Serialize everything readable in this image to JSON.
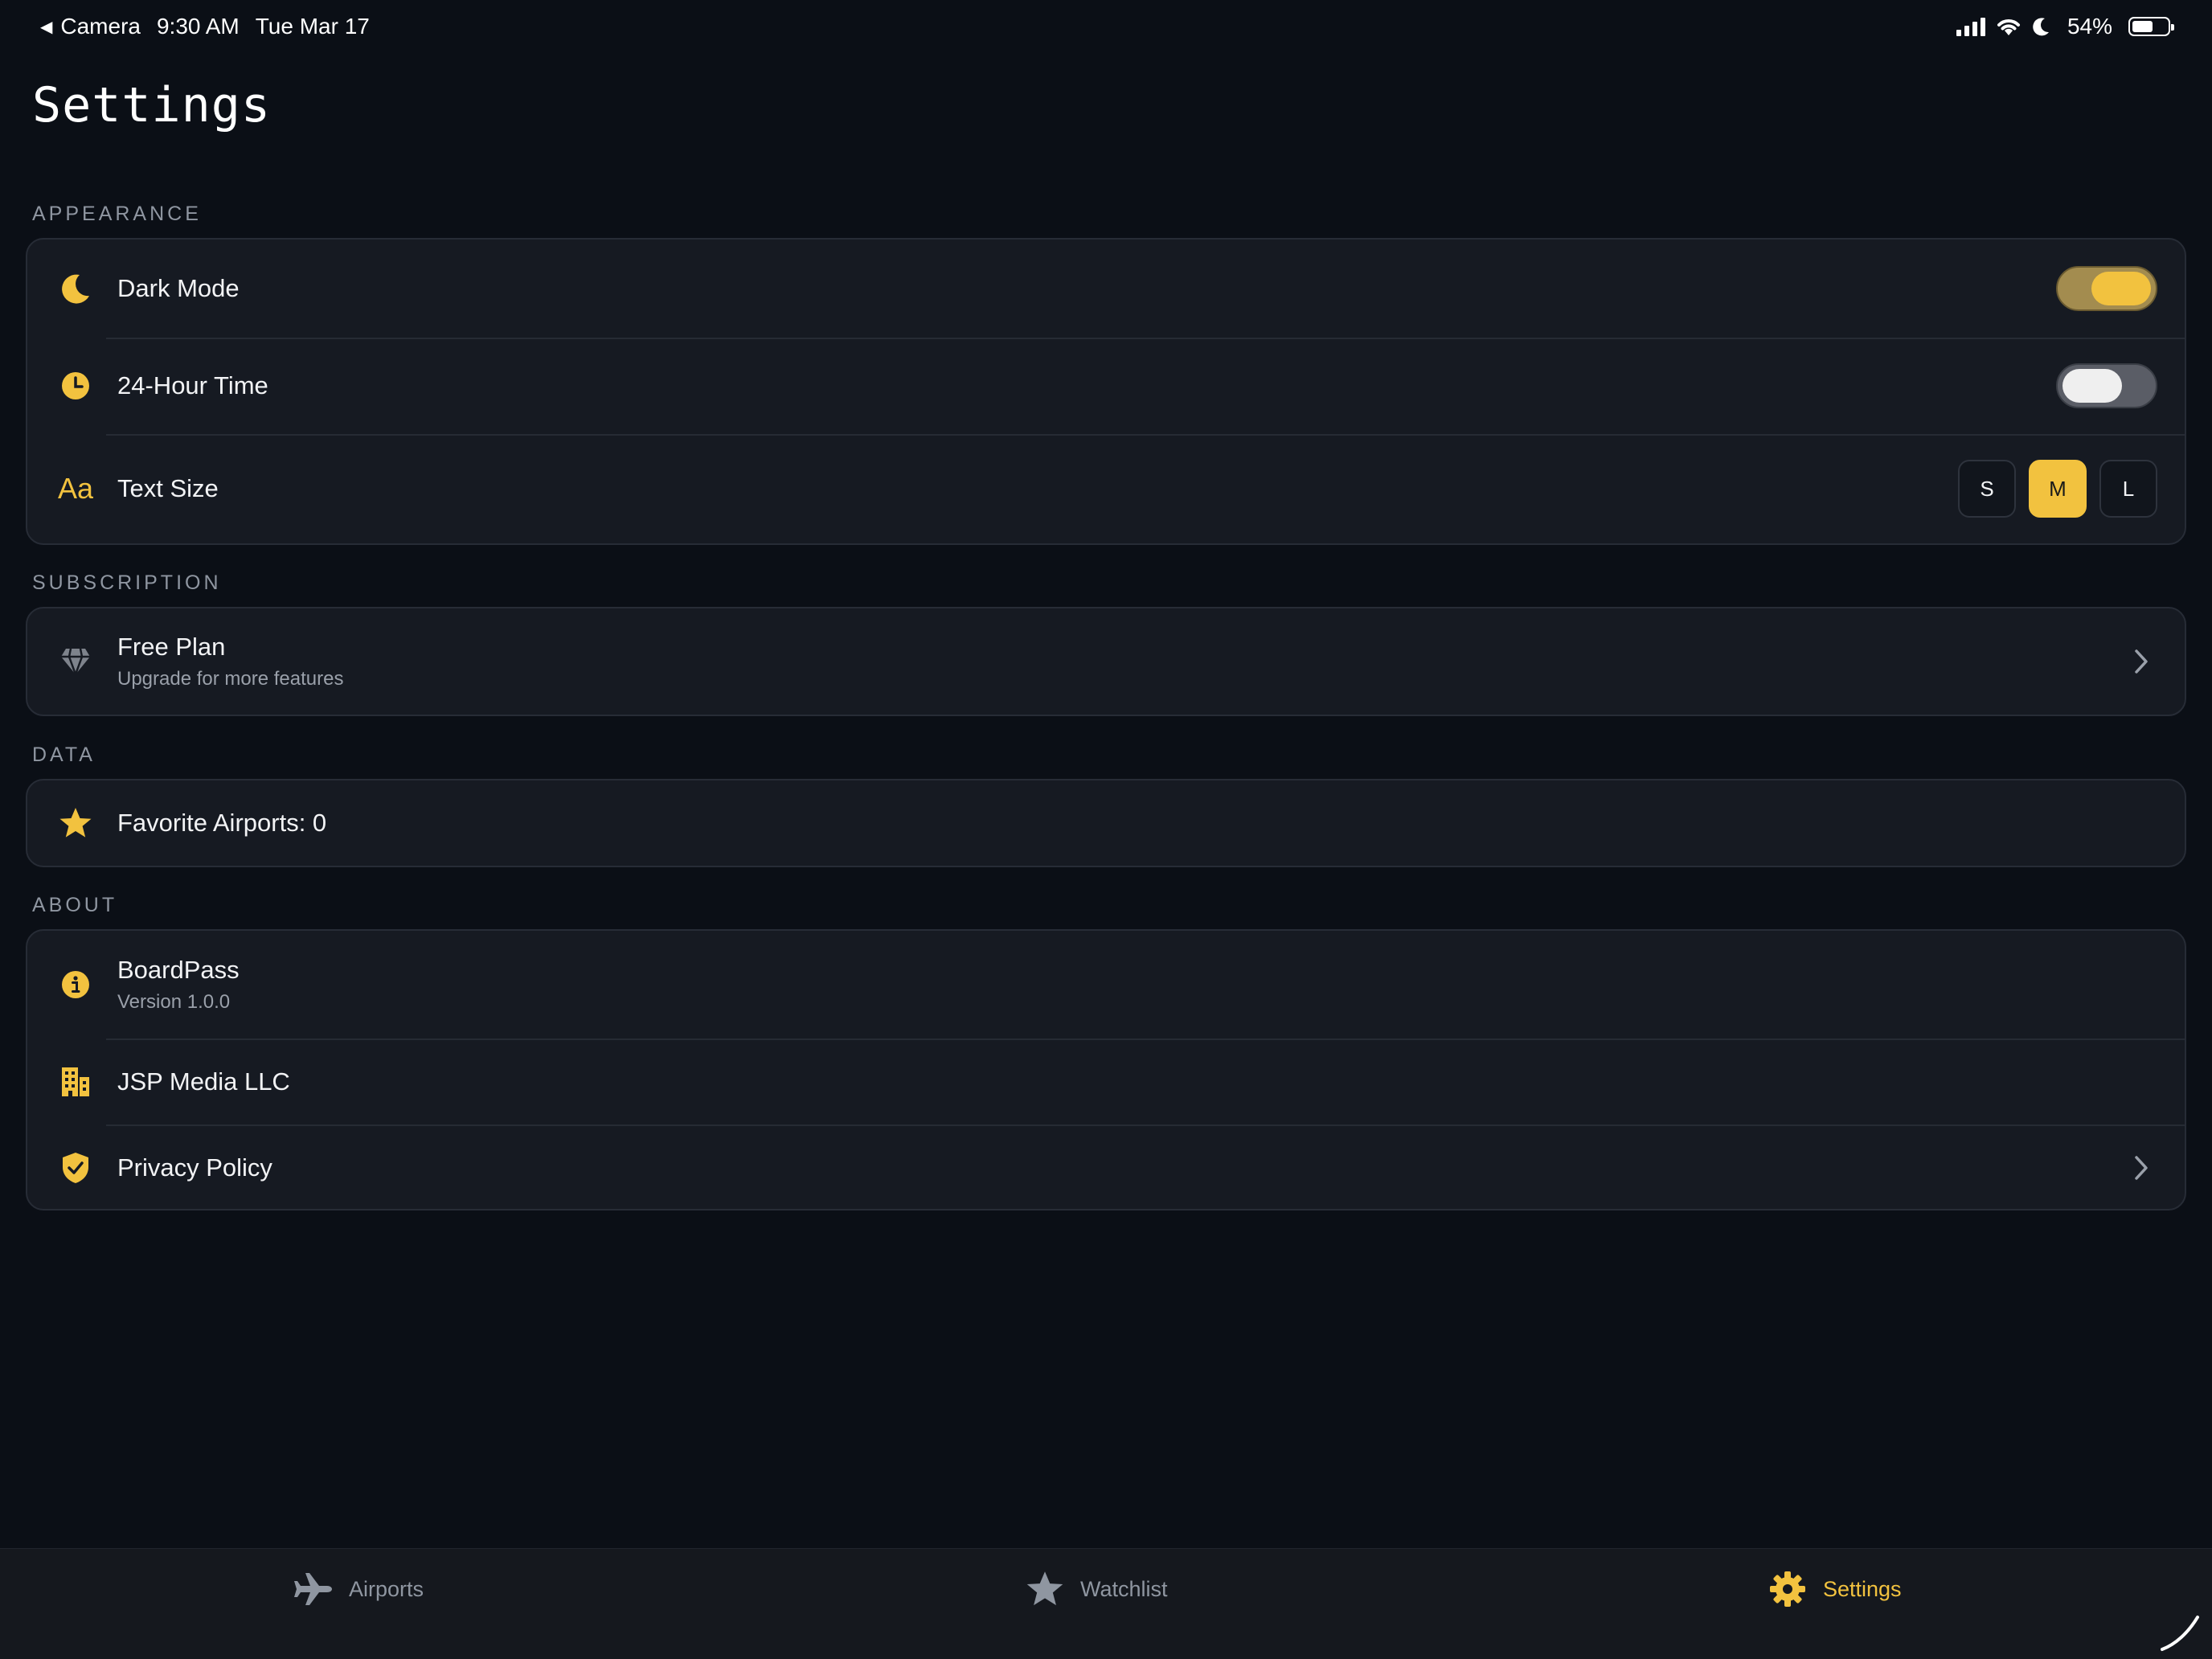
{
  "status_bar": {
    "back_label": "Camera",
    "time": "9:30 AM",
    "date": "Tue Mar 17",
    "battery_percent": "54%",
    "battery_level": 0.54
  },
  "page_title": "Settings",
  "sections": {
    "appearance": {
      "label": "APPEARANCE",
      "dark_mode": {
        "label": "Dark Mode",
        "enabled": true,
        "icon": "moon-icon"
      },
      "hour24": {
        "label": "24-Hour Time",
        "enabled": false,
        "icon": "clock-icon"
      },
      "text_size": {
        "label": "Text Size",
        "icon": "text-size-icon",
        "options": [
          "S",
          "M",
          "L"
        ],
        "selected": "M"
      }
    },
    "subscription": {
      "label": "SUBSCRIPTION",
      "plan": {
        "title": "Free Plan",
        "subtitle": "Upgrade for more features",
        "icon": "diamond-icon"
      }
    },
    "data": {
      "label": "DATA",
      "favorites": {
        "label": "Favorite Airports: 0",
        "icon": "star-icon"
      }
    },
    "about": {
      "label": "ABOUT",
      "app": {
        "title": "BoardPass",
        "subtitle": "Version 1.0.0",
        "icon": "info-icon"
      },
      "company": {
        "title": "JSP Media LLC",
        "icon": "building-icon"
      },
      "privacy": {
        "title": "Privacy Policy",
        "icon": "shield-check-icon"
      }
    }
  },
  "tabs": [
    {
      "label": "Airports",
      "icon": "airplane-icon",
      "active": false
    },
    {
      "label": "Watchlist",
      "icon": "star-icon",
      "active": false
    },
    {
      "label": "Settings",
      "icon": "gear-icon",
      "active": true
    }
  ],
  "colors": {
    "accent": "#f2c23f",
    "background": "#0b0f16",
    "card": "#161a22",
    "muted_text": "#8f96a1"
  }
}
